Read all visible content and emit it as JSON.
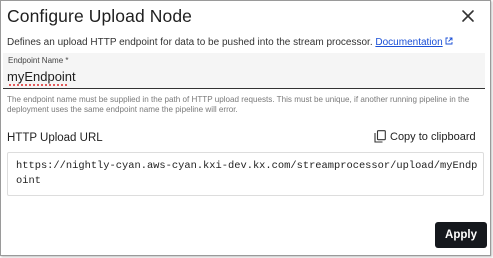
{
  "dialog": {
    "title": "Configure Upload Node",
    "close_icon": "close-icon"
  },
  "description": {
    "text": "Defines an upload HTTP endpoint for data to be pushed into the stream processor.",
    "link_label": "Documentation",
    "link_icon": "external-link-icon"
  },
  "endpoint_field": {
    "label": "Endpoint Name *",
    "value": "myEndpoint",
    "hint": "The endpoint name must be supplied in the path of HTTP upload requests. This must be unique, if another running pipeline in the deployment uses the same endpoint name the pipeline will error."
  },
  "http_upload": {
    "label": "HTTP Upload URL",
    "copy_label": "Copy to clipboard",
    "copy_icon": "copy-icon",
    "url": "https://nightly-cyan.aws-cyan.kxi-dev.kx.com/streamprocessor/upload/myEndpoint"
  },
  "footer": {
    "apply_label": "Apply"
  },
  "colors": {
    "link": "#1a4fd6",
    "apply_bg": "#15181d",
    "field_bg": "#f5f5f5"
  }
}
